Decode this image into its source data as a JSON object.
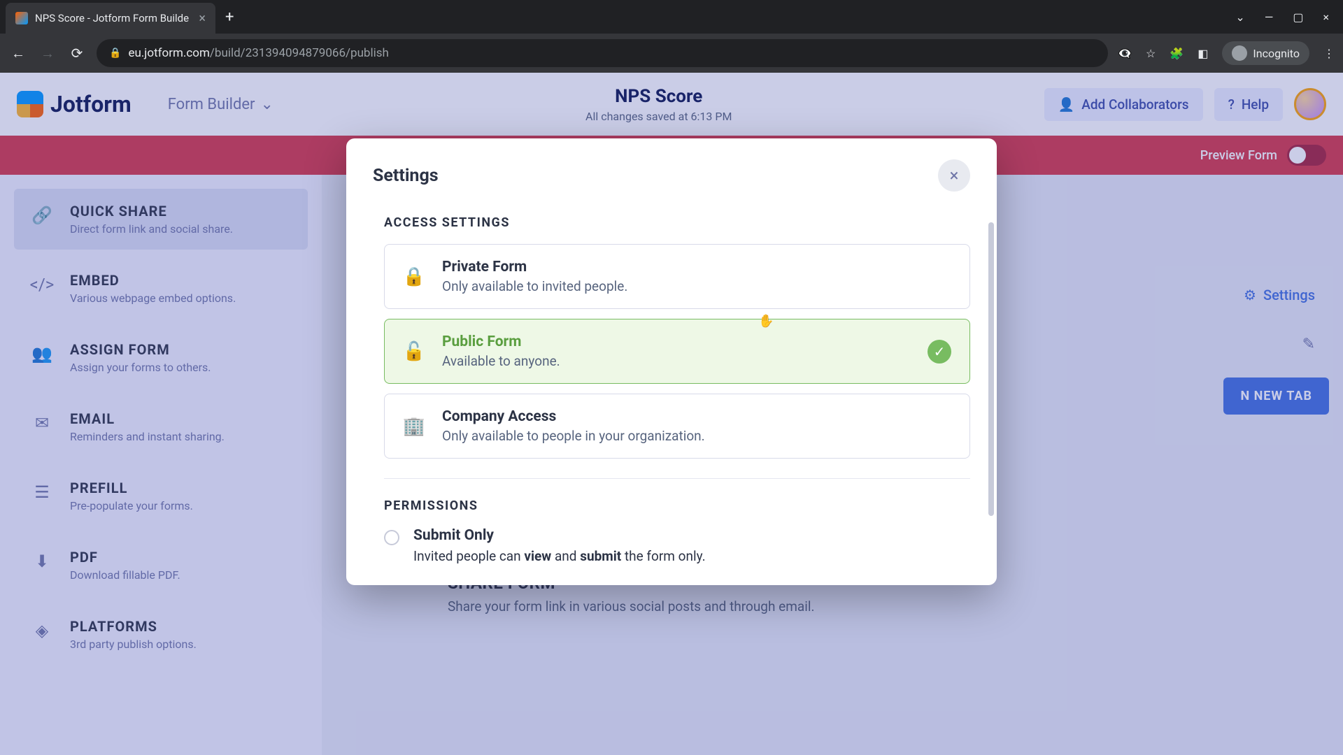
{
  "browser": {
    "tab_title": "NPS Score - Jotform Form Builde",
    "url_domain": "eu.jotform.com",
    "url_path": "/build/231394094879066/publish",
    "incognito": "Incognito"
  },
  "header": {
    "logo": "Jotform",
    "form_builder": "Form Builder",
    "form_title": "NPS Score",
    "save_status": "All changes saved at 6:13 PM",
    "collaborators": "Add Collaborators",
    "help": "Help"
  },
  "tabstrip": {
    "preview": "Preview Form"
  },
  "sidebar": [
    {
      "title": "QUICK SHARE",
      "desc": "Direct form link and social share.",
      "icon": "🔗"
    },
    {
      "title": "EMBED",
      "desc": "Various webpage embed options.",
      "icon": "</>"
    },
    {
      "title": "ASSIGN FORM",
      "desc": "Assign your forms to others.",
      "icon": "👥"
    },
    {
      "title": "EMAIL",
      "desc": "Reminders and instant sharing.",
      "icon": "✉"
    },
    {
      "title": "PREFILL",
      "desc": "Pre-populate your forms.",
      "icon": "☰"
    },
    {
      "title": "PDF",
      "desc": "Download fillable PDF.",
      "icon": "⬇"
    },
    {
      "title": "PLATFORMS",
      "desc": "3rd party publish options.",
      "icon": "◈"
    }
  ],
  "main": {
    "settings_label": "Settings",
    "new_tab": "N NEW TAB",
    "share_title": "SHARE FORM",
    "share_desc": "Share your form link in various social posts and through email."
  },
  "modal": {
    "title": "Settings",
    "access_label": "ACCESS SETTINGS",
    "options": [
      {
        "title": "Private Form",
        "desc": "Only available to invited people.",
        "icon": "🔒"
      },
      {
        "title": "Public Form",
        "desc": "Available to anyone.",
        "icon": "🔓"
      },
      {
        "title": "Company Access",
        "desc": "Only available to people in your organization.",
        "icon": "🏢"
      }
    ],
    "perm_label": "PERMISSIONS",
    "perm_title": "Submit Only",
    "perm_desc_pre": "Invited people can ",
    "perm_desc_b1": "view",
    "perm_desc_mid": " and ",
    "perm_desc_b2": "submit",
    "perm_desc_post": " the form only."
  }
}
